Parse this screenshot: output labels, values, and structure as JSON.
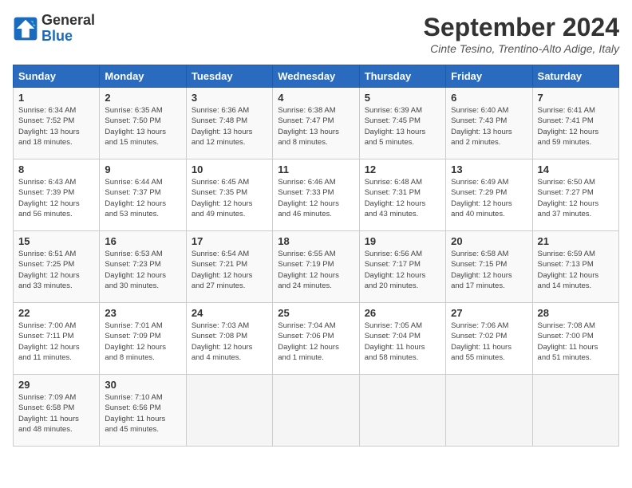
{
  "header": {
    "logo_line1": "General",
    "logo_line2": "Blue",
    "month_title": "September 2024",
    "location": "Cinte Tesino, Trentino-Alto Adige, Italy"
  },
  "days_of_week": [
    "Sunday",
    "Monday",
    "Tuesday",
    "Wednesday",
    "Thursday",
    "Friday",
    "Saturday"
  ],
  "weeks": [
    [
      {
        "day": "1",
        "text": "Sunrise: 6:34 AM\nSunset: 7:52 PM\nDaylight: 13 hours\nand 18 minutes."
      },
      {
        "day": "2",
        "text": "Sunrise: 6:35 AM\nSunset: 7:50 PM\nDaylight: 13 hours\nand 15 minutes."
      },
      {
        "day": "3",
        "text": "Sunrise: 6:36 AM\nSunset: 7:48 PM\nDaylight: 13 hours\nand 12 minutes."
      },
      {
        "day": "4",
        "text": "Sunrise: 6:38 AM\nSunset: 7:47 PM\nDaylight: 13 hours\nand 8 minutes."
      },
      {
        "day": "5",
        "text": "Sunrise: 6:39 AM\nSunset: 7:45 PM\nDaylight: 13 hours\nand 5 minutes."
      },
      {
        "day": "6",
        "text": "Sunrise: 6:40 AM\nSunset: 7:43 PM\nDaylight: 13 hours\nand 2 minutes."
      },
      {
        "day": "7",
        "text": "Sunrise: 6:41 AM\nSunset: 7:41 PM\nDaylight: 12 hours\nand 59 minutes."
      }
    ],
    [
      {
        "day": "8",
        "text": "Sunrise: 6:43 AM\nSunset: 7:39 PM\nDaylight: 12 hours\nand 56 minutes."
      },
      {
        "day": "9",
        "text": "Sunrise: 6:44 AM\nSunset: 7:37 PM\nDaylight: 12 hours\nand 53 minutes."
      },
      {
        "day": "10",
        "text": "Sunrise: 6:45 AM\nSunset: 7:35 PM\nDaylight: 12 hours\nand 49 minutes."
      },
      {
        "day": "11",
        "text": "Sunrise: 6:46 AM\nSunset: 7:33 PM\nDaylight: 12 hours\nand 46 minutes."
      },
      {
        "day": "12",
        "text": "Sunrise: 6:48 AM\nSunset: 7:31 PM\nDaylight: 12 hours\nand 43 minutes."
      },
      {
        "day": "13",
        "text": "Sunrise: 6:49 AM\nSunset: 7:29 PM\nDaylight: 12 hours\nand 40 minutes."
      },
      {
        "day": "14",
        "text": "Sunrise: 6:50 AM\nSunset: 7:27 PM\nDaylight: 12 hours\nand 37 minutes."
      }
    ],
    [
      {
        "day": "15",
        "text": "Sunrise: 6:51 AM\nSunset: 7:25 PM\nDaylight: 12 hours\nand 33 minutes."
      },
      {
        "day": "16",
        "text": "Sunrise: 6:53 AM\nSunset: 7:23 PM\nDaylight: 12 hours\nand 30 minutes."
      },
      {
        "day": "17",
        "text": "Sunrise: 6:54 AM\nSunset: 7:21 PM\nDaylight: 12 hours\nand 27 minutes."
      },
      {
        "day": "18",
        "text": "Sunrise: 6:55 AM\nSunset: 7:19 PM\nDaylight: 12 hours\nand 24 minutes."
      },
      {
        "day": "19",
        "text": "Sunrise: 6:56 AM\nSunset: 7:17 PM\nDaylight: 12 hours\nand 20 minutes."
      },
      {
        "day": "20",
        "text": "Sunrise: 6:58 AM\nSunset: 7:15 PM\nDaylight: 12 hours\nand 17 minutes."
      },
      {
        "day": "21",
        "text": "Sunrise: 6:59 AM\nSunset: 7:13 PM\nDaylight: 12 hours\nand 14 minutes."
      }
    ],
    [
      {
        "day": "22",
        "text": "Sunrise: 7:00 AM\nSunset: 7:11 PM\nDaylight: 12 hours\nand 11 minutes."
      },
      {
        "day": "23",
        "text": "Sunrise: 7:01 AM\nSunset: 7:09 PM\nDaylight: 12 hours\nand 8 minutes."
      },
      {
        "day": "24",
        "text": "Sunrise: 7:03 AM\nSunset: 7:08 PM\nDaylight: 12 hours\nand 4 minutes."
      },
      {
        "day": "25",
        "text": "Sunrise: 7:04 AM\nSunset: 7:06 PM\nDaylight: 12 hours\nand 1 minute."
      },
      {
        "day": "26",
        "text": "Sunrise: 7:05 AM\nSunset: 7:04 PM\nDaylight: 11 hours\nand 58 minutes."
      },
      {
        "day": "27",
        "text": "Sunrise: 7:06 AM\nSunset: 7:02 PM\nDaylight: 11 hours\nand 55 minutes."
      },
      {
        "day": "28",
        "text": "Sunrise: 7:08 AM\nSunset: 7:00 PM\nDaylight: 11 hours\nand 51 minutes."
      }
    ],
    [
      {
        "day": "29",
        "text": "Sunrise: 7:09 AM\nSunset: 6:58 PM\nDaylight: 11 hours\nand 48 minutes."
      },
      {
        "day": "30",
        "text": "Sunrise: 7:10 AM\nSunset: 6:56 PM\nDaylight: 11 hours\nand 45 minutes."
      },
      {
        "day": "",
        "text": ""
      },
      {
        "day": "",
        "text": ""
      },
      {
        "day": "",
        "text": ""
      },
      {
        "day": "",
        "text": ""
      },
      {
        "day": "",
        "text": ""
      }
    ]
  ]
}
